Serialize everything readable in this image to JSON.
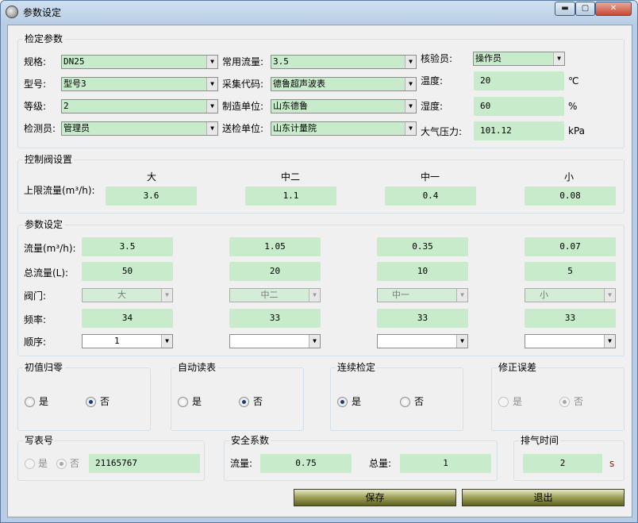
{
  "window": {
    "title": "参数设定",
    "min": "▬",
    "max": "▢",
    "close": "✕"
  },
  "verify": {
    "title": "检定参数",
    "spec_label": "规格:",
    "spec": "DN25",
    "model_label": "型号:",
    "model": "型号3",
    "grade_label": "等级:",
    "grade": "2",
    "inspector_label": "检测员:",
    "inspector": "管理员",
    "flow_label": "常用流量:",
    "flow": "3.5",
    "code_label": "采集代码:",
    "code": "德鲁超声波表",
    "maker_label": "制造单位:",
    "maker": "山东德鲁",
    "sender_label": "送检单位:",
    "sender": "山东计量院",
    "checker_label": "核验员:",
    "checker": "操作员",
    "temp_label": "温度:",
    "temp": "20",
    "temp_unit": "℃",
    "hum_label": "湿度:",
    "hum": "60",
    "hum_unit": "%",
    "press_label": "大气压力:",
    "press": "101.12",
    "press_unit": "kPa"
  },
  "valve": {
    "title": "控制阀设置",
    "heads": [
      "大",
      "中二",
      "中一",
      "小"
    ],
    "limit_label": "上限流量(m³/h):",
    "limits": [
      "3.6",
      "1.1",
      "0.4",
      "0.08"
    ]
  },
  "params": {
    "title": "参数设定",
    "flow_label": "流量(m³/h):",
    "flows": [
      "3.5",
      "1.05",
      "0.35",
      "0.07"
    ],
    "total_label": "总流量(L):",
    "totals": [
      "50",
      "20",
      "10",
      "5"
    ],
    "valve_label": "阀门:",
    "valves": [
      "大",
      "中二",
      "中一",
      "小"
    ],
    "freq_label": "频率:",
    "freqs": [
      "34",
      "33",
      "33",
      "33"
    ],
    "order_label": "顺序:",
    "orders": [
      "1",
      "",
      "",
      ""
    ]
  },
  "zero": {
    "title": "初值归零",
    "yes": "是",
    "no": "否"
  },
  "autoread": {
    "title": "自动读表",
    "yes": "是",
    "no": "否"
  },
  "continuous": {
    "title": "连续检定",
    "yes": "是",
    "no": "否"
  },
  "correct": {
    "title": "修正误差",
    "yes": "是",
    "no": "否"
  },
  "writeno": {
    "title": "写表号",
    "yes": "是",
    "no": "否",
    "value": "21165767"
  },
  "safety": {
    "title": "安全系数",
    "flow_label": "流量:",
    "flow": "0.75",
    "total_label": "总量:",
    "total": "1"
  },
  "exhaust": {
    "title": "排气时间",
    "value": "2",
    "unit": "s"
  },
  "buttons": {
    "save": "保存",
    "exit": "退出"
  },
  "colors": {
    "field": "#c8ebcb",
    "button_dark": "#5f6120"
  },
  "icons": {
    "dropdown": "▼",
    "radio": "radio"
  }
}
